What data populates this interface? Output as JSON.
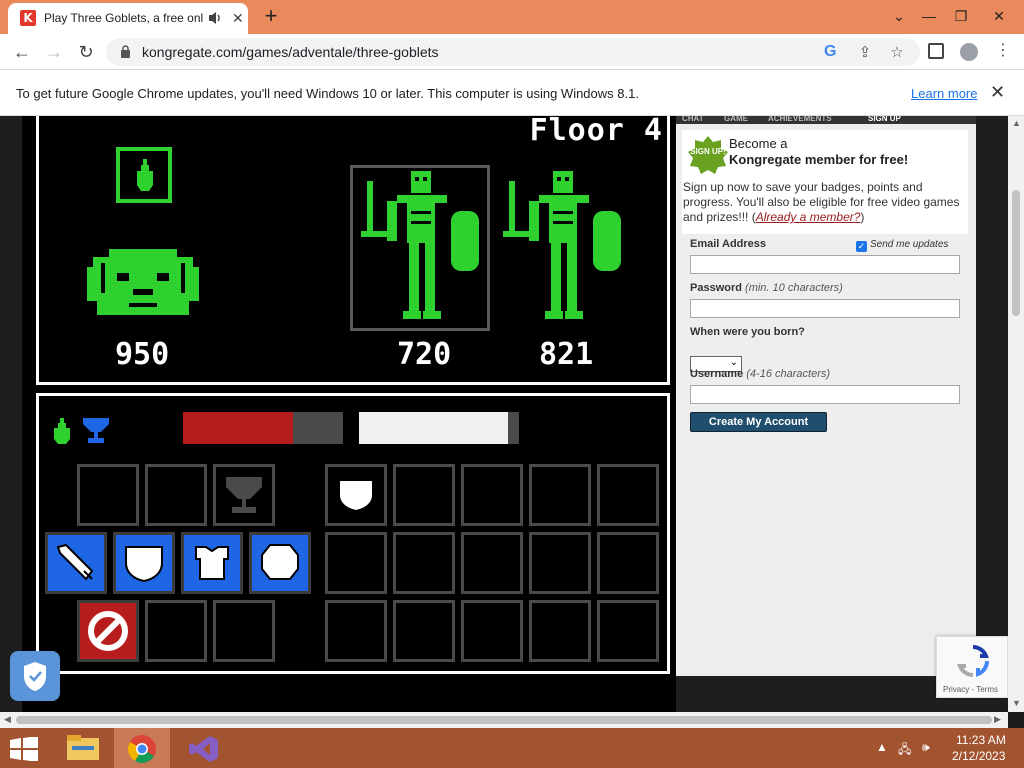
{
  "browser": {
    "tab_title": "Play Three Goblets, a free online game on Kongregate",
    "url": "kongregate.com/games/adventale/three-goblets",
    "tab_favicon": "K",
    "new_tab_glyph": "+",
    "controls": {
      "chevron": "⌄",
      "minimize": "—",
      "restore": "❐",
      "close": "✕"
    }
  },
  "infobar": {
    "message": "To get future Google Chrome updates, you'll need Windows 10 or later. This computer is using Windows 8.1.",
    "link": "Learn more",
    "close": "✕"
  },
  "game": {
    "floor_label": "Floor 4",
    "player_hp": "950",
    "enemies": [
      {
        "name": "skeleton-warrior",
        "hp": "720",
        "selected": true
      },
      {
        "name": "skeleton-warrior",
        "hp": "821",
        "selected": false
      }
    ],
    "health_fraction": 0.69,
    "energy_fraction": 0.93,
    "colors": {
      "monster": "#2fd12f",
      "health": "#b71c1c",
      "slot_blue": "#1f66e5",
      "slot_red": "#b81d1d"
    }
  },
  "sidebar": {
    "tabs": [
      "CHAT",
      "GAME",
      "ACHIEVEMENTS",
      "SIGN UP"
    ],
    "badge_text": "SIGN UP!",
    "become_line1": "Become a",
    "become_line2": "Kongregate member for free!",
    "description": "Sign up now to save your badges, points and progress. You'll also be eligible for free video games and prizes!!! (",
    "already_member": "Already a member?",
    "description_end": ")",
    "email_label": "Email Address",
    "send_updates": "Send me updates",
    "password_label": "Password",
    "password_hint": "(min. 10 characters)",
    "born_label": "When were you born?",
    "username_label": "Username",
    "username_hint": "(4-16 characters)",
    "create_button": "Create My Account"
  },
  "recaptcha": {
    "privacy": "Privacy",
    "separator": " - ",
    "terms": "Terms"
  },
  "taskbar": {
    "time": "11:23 AM",
    "date": "2/12/2023"
  }
}
